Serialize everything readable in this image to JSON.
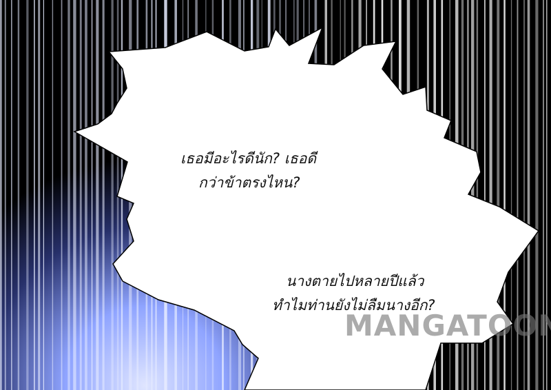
{
  "dialogue": {
    "bubble_main": {
      "line1": "เธอมีอะไรดีนัก? เธอดี",
      "line2": "กว่าข้าตรงไหน?",
      "line3": "นางตายไปหลายปีแล้ว",
      "line4": "ทำไมท่านยังไม่ลืมนางอีก?"
    }
  },
  "watermark": {
    "text": "MANGATOON"
  },
  "colors": {
    "background": "#000000",
    "bubble": "#ffffff",
    "glow": "#8fa4ff",
    "text": "#111111"
  }
}
